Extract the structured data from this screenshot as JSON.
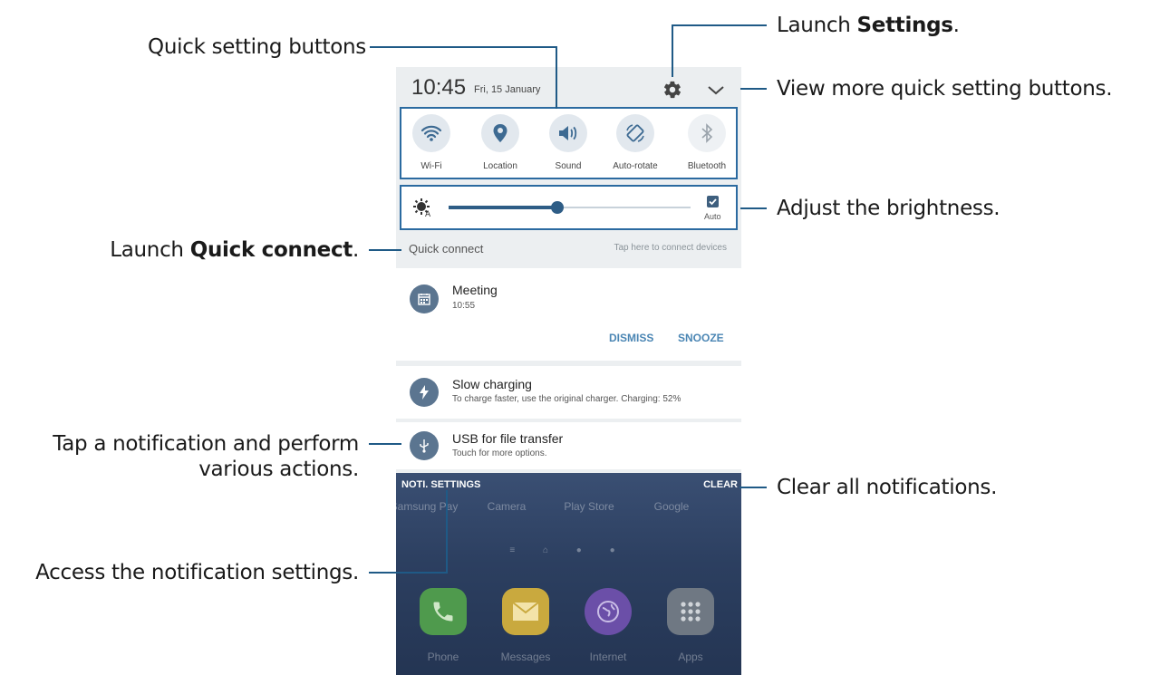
{
  "callouts": {
    "quick_setting_buttons": "Quick setting buttons",
    "launch_settings_prefix": "Launch ",
    "launch_settings_bold": "Settings",
    "launch_settings_suffix": ".",
    "view_more": "View more quick setting buttons.",
    "adjust_brightness": "Adjust the brightness.",
    "launch_qc_prefix": "Launch ",
    "launch_qc_bold": "Quick connect",
    "launch_qc_suffix": ".",
    "tap_notification_line1": "Tap a notification and perform",
    "tap_notification_line2": "various actions.",
    "clear_all": "Clear all notifications.",
    "access_settings": "Access the notification settings."
  },
  "status_bar": {
    "time": "10:45",
    "date": "Fri, 15 January",
    "settings_icon": "gear-icon",
    "expand_icon": "chevron-down-icon"
  },
  "quick_settings": [
    {
      "label": "Wi-Fi",
      "icon": "wifi-icon"
    },
    {
      "label": "Location",
      "icon": "location-pin-icon"
    },
    {
      "label": "Sound",
      "icon": "speaker-icon"
    },
    {
      "label": "Auto-rotate",
      "icon": "auto-rotate-icon"
    },
    {
      "label": "Bluetooth",
      "icon": "bluetooth-icon"
    }
  ],
  "brightness": {
    "level": 0.45,
    "auto_label": "Auto",
    "auto_checked": true
  },
  "quick_connect": {
    "label": "Quick connect",
    "hint": "Tap here to connect devices"
  },
  "notifications": [
    {
      "title": "Meeting",
      "text": "10:55",
      "icon": "calendar-icon",
      "actions": [
        "DISMISS",
        "SNOOZE"
      ]
    },
    {
      "title": "Slow charging",
      "text": "To charge faster, use the original charger. Charging: 52%",
      "icon": "lightning-icon"
    },
    {
      "title": "USB for file transfer",
      "text": "Touch for more options.",
      "icon": "usb-icon"
    }
  ],
  "panel_footer": {
    "noti_settings": "NOTI. SETTINGS",
    "clear": "CLEAR"
  },
  "home_screen": {
    "top_apps": [
      "Samsung Pay",
      "Camera",
      "Play Store",
      "Google"
    ],
    "dock_apps": [
      "Phone",
      "Messages",
      "Internet",
      "Apps"
    ]
  },
  "colors": {
    "accent": "#2b6aa0",
    "action_text": "#4b86b4",
    "icon_circle": "#5b7590"
  }
}
